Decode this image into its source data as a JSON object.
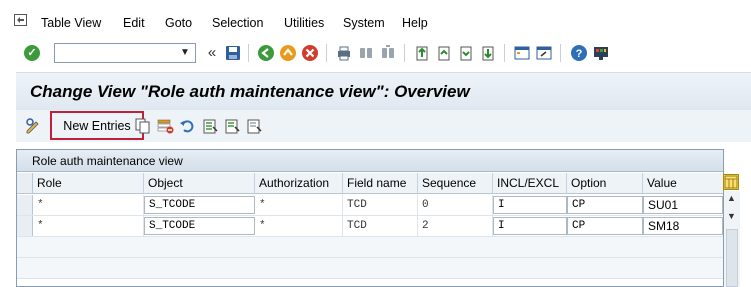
{
  "menu": {
    "items": [
      "Table View",
      "Edit",
      "Goto",
      "Selection",
      "Utilities",
      "System",
      "Help"
    ]
  },
  "toolbar": {
    "command_value": "",
    "ok_icon": "check-icon",
    "expand_label": "«"
  },
  "title": "Change View \"Role auth maintenance view\": Overview",
  "app_toolbar": {
    "new_entries_label": "New Entries"
  },
  "table": {
    "title": "Role auth maintenance view",
    "columns": [
      "Role",
      "Object",
      "Authorization",
      "Field name",
      "Sequence",
      "INCL/EXCL",
      "Option",
      "Value"
    ],
    "rows": [
      [
        "*",
        "S_TCODE",
        "*",
        "TCD",
        "0",
        "I",
        "CP",
        "SU01"
      ],
      [
        "*",
        "S_TCODE",
        "*",
        "TCD",
        "2",
        "I",
        "CP",
        "SM18"
      ]
    ]
  },
  "colors": {
    "highlight_border": "#c0203a",
    "title_bg": "#dfe8f1"
  }
}
